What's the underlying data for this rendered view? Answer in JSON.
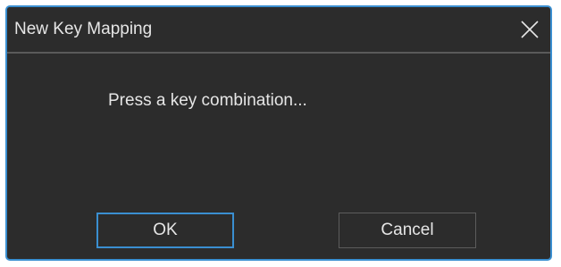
{
  "dialog": {
    "title": "New Key Mapping",
    "message": "Press a key combination...",
    "ok_label": "OK",
    "cancel_label": "Cancel"
  },
  "colors": {
    "background": "#2c2c2c",
    "accent_border": "#3a8fd1",
    "text": "#e6e6e6",
    "divider": "#5a5a5a"
  },
  "icons": {
    "close": "close-icon"
  }
}
